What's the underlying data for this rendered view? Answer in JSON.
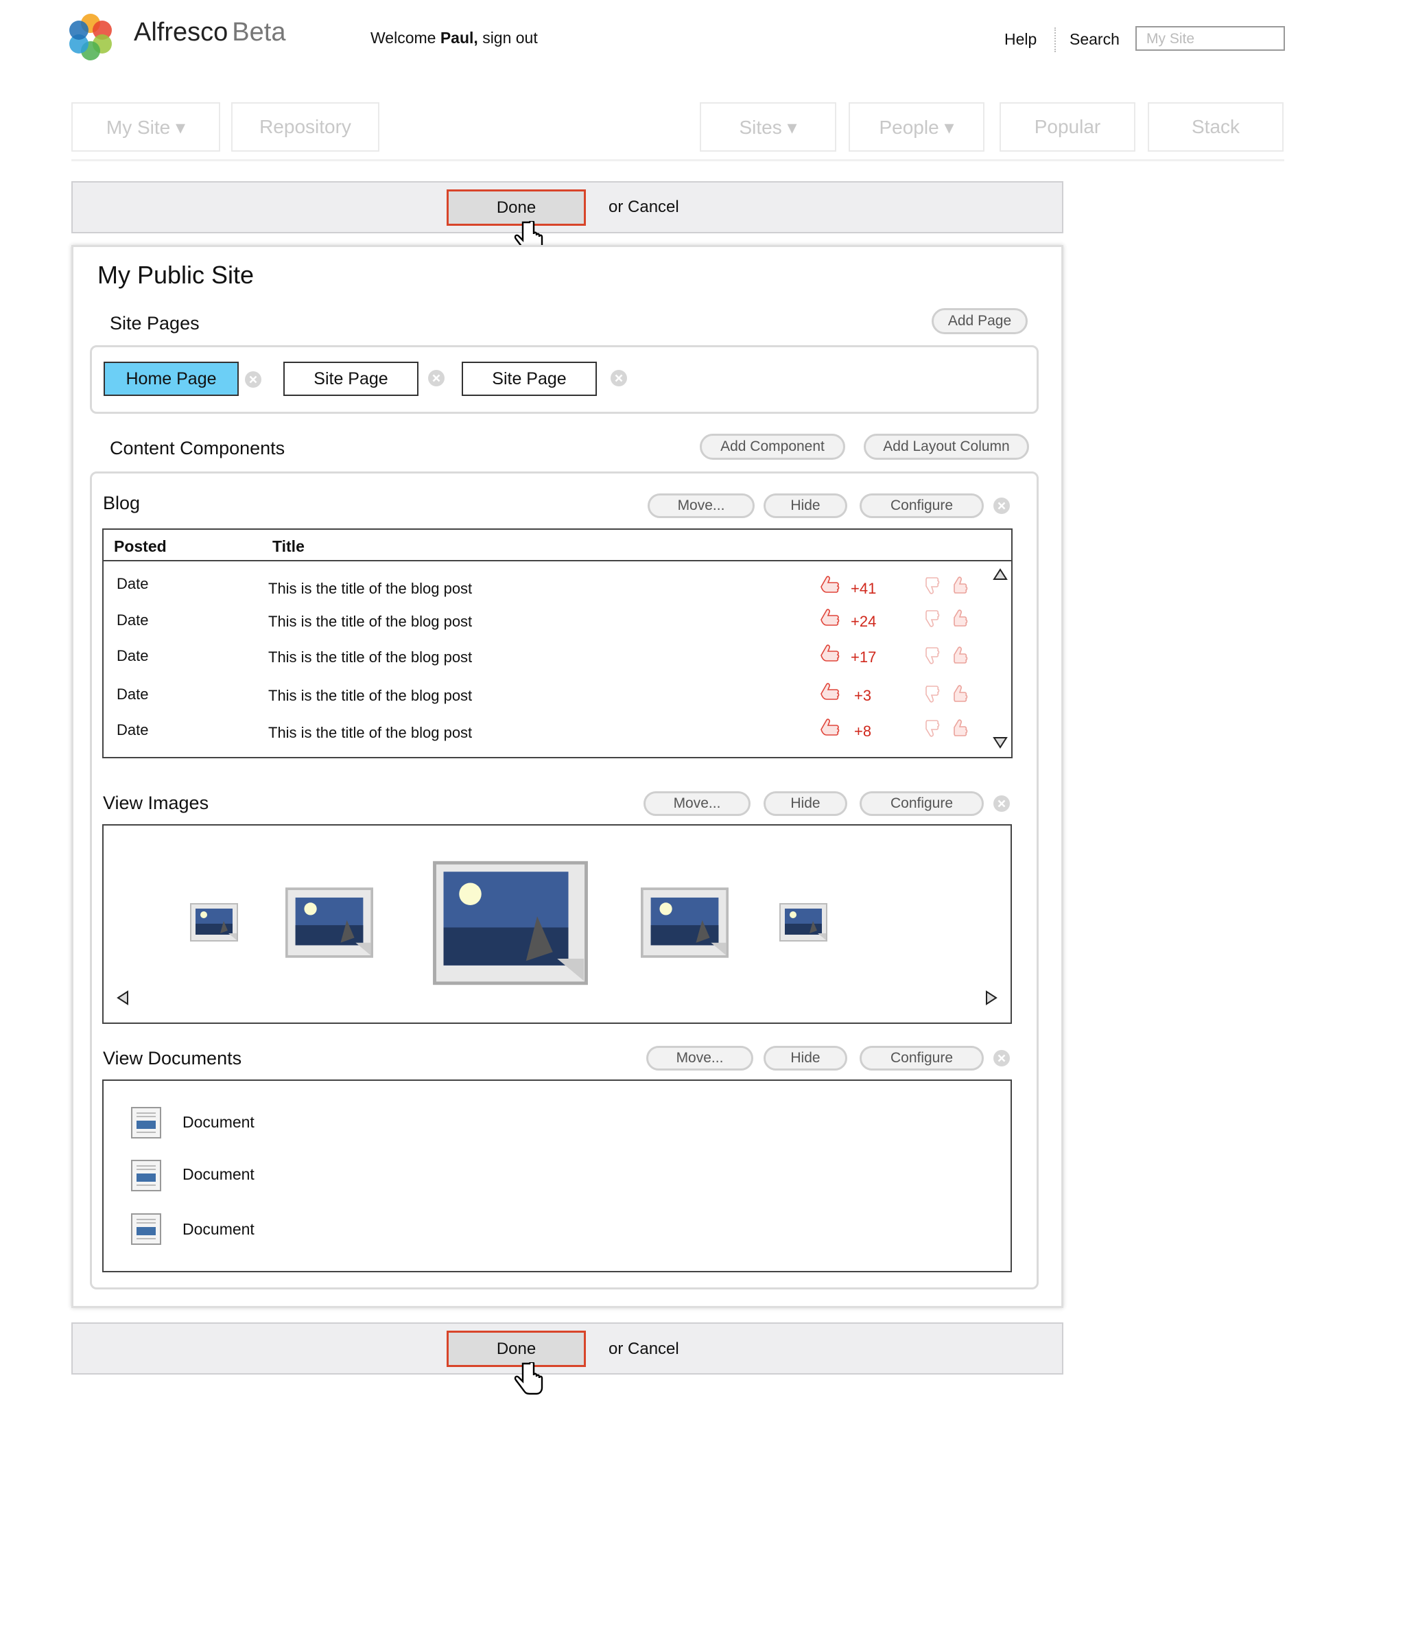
{
  "header": {
    "brand": "Alfresco",
    "brand_suffix": "Beta",
    "welcome_prefix": "Welcome",
    "user": "Paul,",
    "sign_out": "sign out",
    "help": "Help",
    "search": "Search",
    "search_placeholder": "My Site"
  },
  "nav": {
    "my_site": "My Site ▾",
    "repository": "Repository",
    "sites": "Sites ▾",
    "people": "People ▾",
    "popular": "Popular",
    "stack": "Stack"
  },
  "action_bar": {
    "done": "Done",
    "cancel": "or Cancel"
  },
  "page": {
    "title": "My Public Site",
    "site_pages_label": "Site Pages",
    "add_page": "Add Page",
    "tabs": [
      "Home Page",
      "Site Page",
      "Site Page"
    ],
    "content_components_label": "Content Components",
    "add_component": "Add Component",
    "add_layout_column": "Add Layout Column"
  },
  "component_actions": {
    "move": "Move...",
    "hide": "Hide",
    "configure": "Configure"
  },
  "blog": {
    "title": "Blog",
    "col_posted": "Posted",
    "col_title": "Title",
    "rows": [
      {
        "date": "Date",
        "title": "This is the title of the blog post",
        "score": "+41"
      },
      {
        "date": "Date",
        "title": "This is the title of the blog post",
        "score": "+24"
      },
      {
        "date": "Date",
        "title": "This is the title of the blog post",
        "score": "+17"
      },
      {
        "date": "Date",
        "title": "This is the title of the blog post",
        "score": "+3"
      },
      {
        "date": "Date",
        "title": "This is the title of the blog post",
        "score": "+8"
      }
    ]
  },
  "images": {
    "title": "View Images"
  },
  "documents": {
    "title": "View Documents",
    "items": [
      "Document",
      "Document",
      "Document"
    ]
  },
  "colors": {
    "accent_red": "#d8452a",
    "active_tab": "#6ccff6",
    "score_red": "#d0281c"
  }
}
